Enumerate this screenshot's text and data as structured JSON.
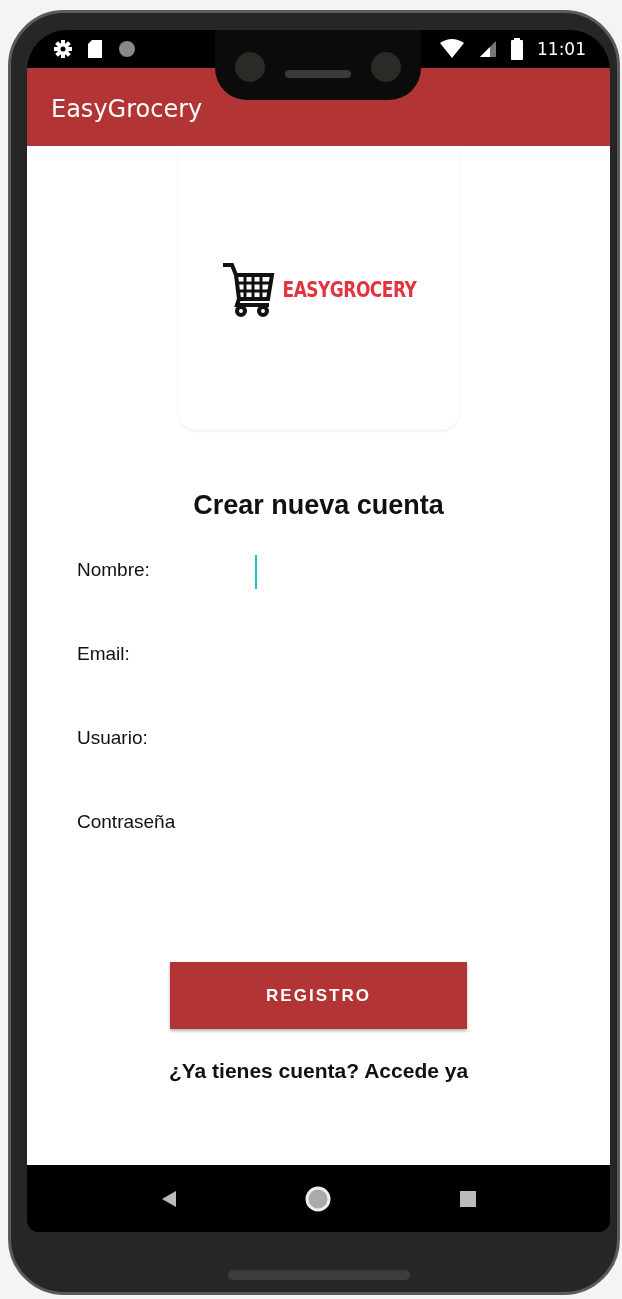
{
  "status_bar": {
    "time": "11:01"
  },
  "app_bar": {
    "title": "EasyGrocery"
  },
  "logo": {
    "wordmark": "EASYGROCERY"
  },
  "heading": "Crear nueva cuenta",
  "fields": [
    {
      "label": "Nombre:",
      "focused": true
    },
    {
      "label": "Email:",
      "focused": false
    },
    {
      "label": "Usuario:",
      "focused": false
    },
    {
      "label": "Contraseña",
      "focused": false
    }
  ],
  "register_button": "REGISTRO",
  "login_link": "¿Ya tienes cuenta? Accede ya"
}
